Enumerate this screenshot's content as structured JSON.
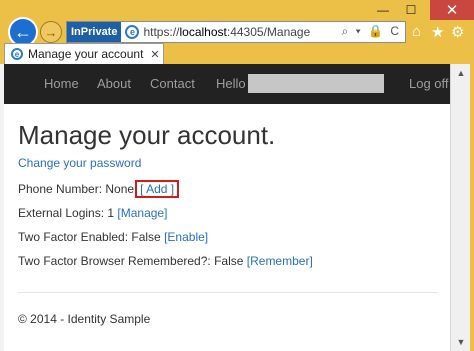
{
  "window": {
    "minimize_glyph": "—",
    "maximize_glyph": "☐",
    "close_glyph": "✕"
  },
  "browser": {
    "inprivate_label": "InPrivate",
    "address": {
      "url_prefix": "https://",
      "url_host": "localhost",
      "url_rest": ":44305/Manage"
    },
    "address_icons": "⌕ ▾ 🔒 C",
    "toolbar_icons": [
      "home-icon",
      "star-icon",
      "gear-icon"
    ],
    "tab": {
      "label": "Manage your account - Ide...",
      "close_glyph": "✕"
    }
  },
  "site": {
    "nav": {
      "home": "Home",
      "about": "About",
      "contact": "Contact",
      "hello": "Hello",
      "logoff": "Log off"
    },
    "title": "Manage your account.",
    "change_password": "Change your password",
    "phone": {
      "label": "Phone Number: None",
      "action": "[ Add ]"
    },
    "external_logins": {
      "label": "External Logins: 1",
      "action": "[Manage]"
    },
    "two_factor": {
      "label": "Two Factor Enabled: False",
      "action": "[Enable]"
    },
    "two_factor_browser": {
      "label": "Two Factor Browser Remembered?: False",
      "action": "[Remember]"
    },
    "footer": "© 2014 - Identity Sample"
  },
  "colors": {
    "chrome": "#ecc046",
    "navbar": "#222222",
    "link": "#2a6fbf",
    "highlight": "#d11c1c"
  }
}
